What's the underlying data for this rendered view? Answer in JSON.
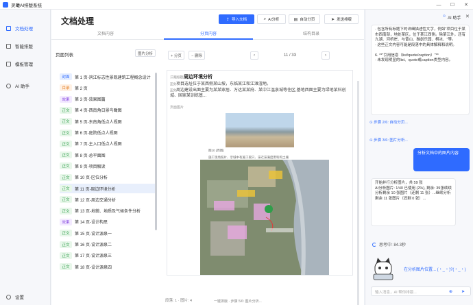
{
  "window": {
    "title": "灵曦AI排版系统"
  },
  "sidebar": {
    "items": [
      {
        "label": "文档处理",
        "icon": "document-icon"
      },
      {
        "label": "智能排版",
        "icon": "layout-icon"
      },
      {
        "label": "模板管理",
        "icon": "template-icon"
      },
      {
        "label": "AI 助手",
        "icon": "assistant-icon"
      }
    ],
    "settings_label": "设置"
  },
  "main": {
    "title": "文档处理",
    "toolbar": {
      "import_label": "导入文档",
      "ai_analyze_label": "AI分析",
      "auto_split_label": "自动分页",
      "send_layout_label": "发送排版"
    },
    "tabs": [
      "文档内容",
      "分页内容",
      "结构目录"
    ],
    "active_tab": 1
  },
  "pagelist": {
    "header": "页面列表",
    "analyze_button": "图片分析",
    "rows": [
      {
        "tag": "封面",
        "tag_type": "cover",
        "text": "第 1 页-滨江标志性景观建筑工程概念设计"
      },
      {
        "tag": "目录",
        "tag_type": "toc",
        "text": "第 2 页"
      },
      {
        "tag": "效果",
        "tag_type": "effect",
        "text": "第 3 页-效果图篇"
      },
      {
        "tag": "正文",
        "tag_type": "body",
        "text": "第 4 页-西南角日景鸟瞰图"
      },
      {
        "tag": "正文",
        "tag_type": "body",
        "text": "第 5 页-东南角低点人视图"
      },
      {
        "tag": "正文",
        "tag_type": "body",
        "text": "第 6 页-庭院低点人视图"
      },
      {
        "tag": "正文",
        "tag_type": "body",
        "text": "第 7 页-主入口低点人视图"
      },
      {
        "tag": "正文",
        "tag_type": "body",
        "text": "第 8 页-总平面图"
      },
      {
        "tag": "正文",
        "tag_type": "body",
        "text": "第 9 页-项目解读"
      },
      {
        "tag": "正文",
        "tag_type": "body",
        "text": "第 10 页-区位分析"
      },
      {
        "tag": "正文",
        "tag_type": "body",
        "text": "第 11 页-周边环境分析"
      },
      {
        "tag": "正文",
        "tag_type": "body",
        "text": "第 12 页-周边交通分析"
      },
      {
        "tag": "正文",
        "tag_type": "body",
        "text": "第 13 页-地貌、地质及气候条件分析"
      },
      {
        "tag": "效果",
        "tag_type": "effect",
        "text": "第 14 页-设计构思"
      },
      {
        "tag": "正文",
        "tag_type": "body",
        "text": "第 15 页-设计源泉一"
      },
      {
        "tag": "正文",
        "tag_type": "body",
        "text": "第 16 页-设计源泉二"
      },
      {
        "tag": "正文",
        "tag_type": "body",
        "text": "第 17 页-设计源泉三"
      },
      {
        "tag": "正文",
        "tag_type": "body",
        "text": "第 18 页-设计源泉四"
      }
    ],
    "selected_index": 10
  },
  "editor": {
    "add_page_label": "+ 分页",
    "delete_label": "− 删除",
    "page_indicator": "11 / 33",
    "prev_icon": "chevron-left-icon",
    "next_icon": "chevron-right-icon",
    "heading_prefix": "二级标题",
    "heading": "周边环境分析",
    "para1_label": "正文",
    "para1": "项目选址位于某西侧某山坡，东临某江和江滩湿地。",
    "para2_label": "正文",
    "para2": "周边建设出面主要为某某家居、万达某某府、某中江温泉城等住区,基地西面主要为绿地某科创城、国家某训练基...",
    "image_label": "页面图片",
    "img1_caption": "图10 (周围)",
    "img2_caption": "施工现场照片、示城中有施工取只、滞迁滞满度用科和土壤",
    "footer": "段落: 1 · 图片: 4",
    "status": "一键排版 · 步骤 5/6: 图片分析..."
  },
  "chat": {
    "header_label": "AI 助手",
    "assistant_text": "· 包含所有标题下的详细描述性文字，例如\"项目位于某市西南部，地处某区，位于某江西侧。除某江外，还有九湖、河桥岸、与普山、融創乐园、桐冰、\"等。\n· 这些正文内容可能是段落中的具体解释和说明。\n\n6. **\"引用信息（list/quote/caption）\"**\n· 未发现明显的list、quote或caption类型内容。",
    "step1": "步骤 2/6: 自动分页...",
    "step2": "步骤 3/6: 图片分析...",
    "user_message": "分析文档中的图片内容",
    "progress_text": "开始并行分析图片，共 59 张\nAI分析图片: 1/40 已使用 (2%), 剩余: 39张续续分析剩余 10 张图片（还剩 11 张）...继续分析剩余 11 张图片（还剩 0 张）...",
    "thinking": "思考中: 84.3秒",
    "mascot_text": "在分析图片位置... (・_・)?(・_・)",
    "input_placeholder": "输入消息，AI 帮你排版..."
  }
}
